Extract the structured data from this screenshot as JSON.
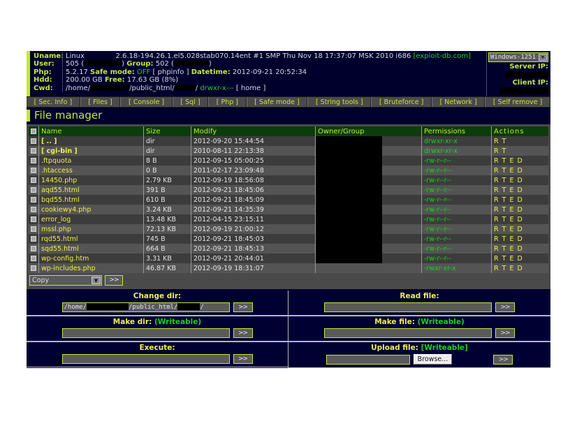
{
  "colors": {
    "accent": "#c3e834",
    "yellow": "#f0f04a",
    "green": "#1ad11a",
    "red": "#ff3030",
    "panel_bg": "#00002d",
    "table_header": "#0b3d0b"
  },
  "header": {
    "rows": [
      {
        "key": "Uname:",
        "value": "Linux             2.6.18-194.26.1.el5.028stab070.14ent #1 SMP Thu Nov 18 17:37:07 MSK 2010 i686 [exploit-db.com]"
      },
      {
        "key": "User:",
        "value": "505 (          ) Group: 502 (          )"
      },
      {
        "key": "Php:",
        "value": "5.2.17 Safe mode: OFF [ phpinfo ] Datetime: 2012-09-21 20:52:34"
      },
      {
        "key": "Hdd:",
        "value": "200.00 GB Free: 17.63 GB (8%)"
      },
      {
        "key": "Cwd:",
        "value": "/home/          /public_html/      / drwxr-x--- [ home ]"
      }
    ],
    "uname_label": "Uname:",
    "uname_os": "Linux",
    "uname_kernel": "2.6.18-194.26.1.el5.028stab070.14ent #1 SMP Thu Nov 18 17:37:07 MSK 2010 i686",
    "uname_tag": "[exploit-db.com]",
    "user_label": "User:",
    "user_uid": "505 (",
    "user_uid_close": ")",
    "user_group_label": "Group:",
    "user_gid": "502 (",
    "user_gid_close": ")",
    "php_label": "Php:",
    "php_version": "5.2.17",
    "safe_mode_label": "Safe mode:",
    "safe_mode_value": "OFF",
    "phpinfo_link": "[ phpinfo ]",
    "datetime_label": "Datetime:",
    "datetime_value": "2012-09-21 20:52:34",
    "hdd_label": "Hdd:",
    "hdd_total": "200.00 GB",
    "hdd_free_label": "Free:",
    "hdd_free_value": "17.63 GB (8%)",
    "cwd_label": "Cwd:",
    "cwd_part1": "/home/",
    "cwd_part2": "/public_html/",
    "cwd_part3": "/",
    "cwd_perms": "drwxr-x---",
    "cwd_home_link": "[ home ]",
    "encoding_selected": "Windows-1251",
    "server_ip_label": "Server IP:",
    "client_ip_label": "Client IP:"
  },
  "menu": [
    {
      "label": "[ Sec. Info ]"
    },
    {
      "label": "[ Files ]"
    },
    {
      "label": "[ Console ]"
    },
    {
      "label": "[ Sql ]"
    },
    {
      "label": "[ Php ]"
    },
    {
      "label": "[ Safe mode ]"
    },
    {
      "label": "[ String tools ]"
    },
    {
      "label": "[ Bruteforce ]"
    },
    {
      "label": "[ Network ]"
    },
    {
      "label": "[ Self remove ]"
    }
  ],
  "page_title": "File manager",
  "table": {
    "headers": [
      "Name",
      "Size",
      "Modify",
      "Owner/Group",
      "Permissions",
      "Actions"
    ],
    "rows": [
      {
        "name": "[ .. ]",
        "size": "dir",
        "modify": "2012-09-20 15:44:54",
        "perms": "drwxr-xr-x",
        "actions": "R T",
        "is_dir": true
      },
      {
        "name": "[ cgi-bin ]",
        "size": "dir",
        "modify": "2010-08-11 22:13:38",
        "perms": "drwxr-xr-x",
        "actions": "R T",
        "is_dir": true
      },
      {
        "name": ".ftpquota",
        "size": "8 B",
        "modify": "2012-09-15 05:00:25",
        "perms": "-rw-r--r--",
        "actions": "R T E D",
        "is_dir": false
      },
      {
        "name": ".htaccess",
        "size": "0 B",
        "modify": "2011-02-17 23:09:48",
        "perms": "-rw-r--r--",
        "actions": "R T E D",
        "is_dir": false
      },
      {
        "name": "14450.php",
        "size": "2.79 KB",
        "modify": "2012-09-19 18:56:08",
        "perms": "-rw-r--r--",
        "actions": "R T E D",
        "is_dir": false
      },
      {
        "name": "aqd55.html",
        "size": "391 B",
        "modify": "2012-09-21 18:45:06",
        "perms": "-rw-r--r--",
        "actions": "R T E D",
        "is_dir": false
      },
      {
        "name": "bqd55.html",
        "size": "610 B",
        "modify": "2012-09-21 18:45:09",
        "perms": "-rw-r--r--",
        "actions": "R T E D",
        "is_dir": false
      },
      {
        "name": "cookiewy4.php",
        "size": "3.24 KB",
        "modify": "2012-09-21 14:35:39",
        "perms": "-rw-r--r--",
        "actions": "R T E D",
        "is_dir": false
      },
      {
        "name": "error_log",
        "size": "13.48 KB",
        "modify": "2012-04-15 23:15:11",
        "perms": "-rw-r--r--",
        "actions": "R T E D",
        "is_dir": false
      },
      {
        "name": "mssl.php",
        "size": "72.13 KB",
        "modify": "2012-09-19 21:00:12",
        "perms": "-rw-r--r--",
        "actions": "R T E D",
        "is_dir": false
      },
      {
        "name": "rqd55.html",
        "size": "745 B",
        "modify": "2012-09-21 18:45:03",
        "perms": "-rw-r--r--",
        "actions": "R T E D",
        "is_dir": false
      },
      {
        "name": "sqd55.html",
        "size": "664 B",
        "modify": "2012-09-21 18:45:13",
        "perms": "-rw-r--r--",
        "actions": "R T E D",
        "is_dir": false
      },
      {
        "name": "wp-config.htm",
        "size": "3.31 KB",
        "modify": "2012-09-21 20:44:01",
        "perms": "-rw-r--r--",
        "actions": "R T E D",
        "is_dir": false
      },
      {
        "name": "wp-includes.php",
        "size": "46.87 KB",
        "modify": "2012-09-19 18:31:07",
        "perms": "-rwxr-xr-x",
        "actions": "R T E D",
        "is_dir": false
      }
    ],
    "bulk_action_selected": "Copy",
    "bulk_go_label": ">>"
  },
  "forms": {
    "change_dir": {
      "label": "Change dir:",
      "value_part1": "/home/",
      "value_part2": "/public_html/",
      "value_part3": "/",
      "go_label": ">>"
    },
    "read_file": {
      "label": "Read file:",
      "value": "",
      "go_label": ">>"
    },
    "make_dir": {
      "label": "Make dir:",
      "writeable": "(Writeable)",
      "value": "",
      "go_label": ">>"
    },
    "make_file": {
      "label": "Make file:",
      "writeable": "(Writeable)",
      "value": "",
      "go_label": ">>"
    },
    "execute": {
      "label": "Execute:",
      "value": "",
      "go_label": ">>"
    },
    "upload_file": {
      "label": "Upload file:",
      "writeable": "[Writeable]",
      "value": "",
      "browse_label": "Browse...",
      "go_label": ">>"
    }
  }
}
